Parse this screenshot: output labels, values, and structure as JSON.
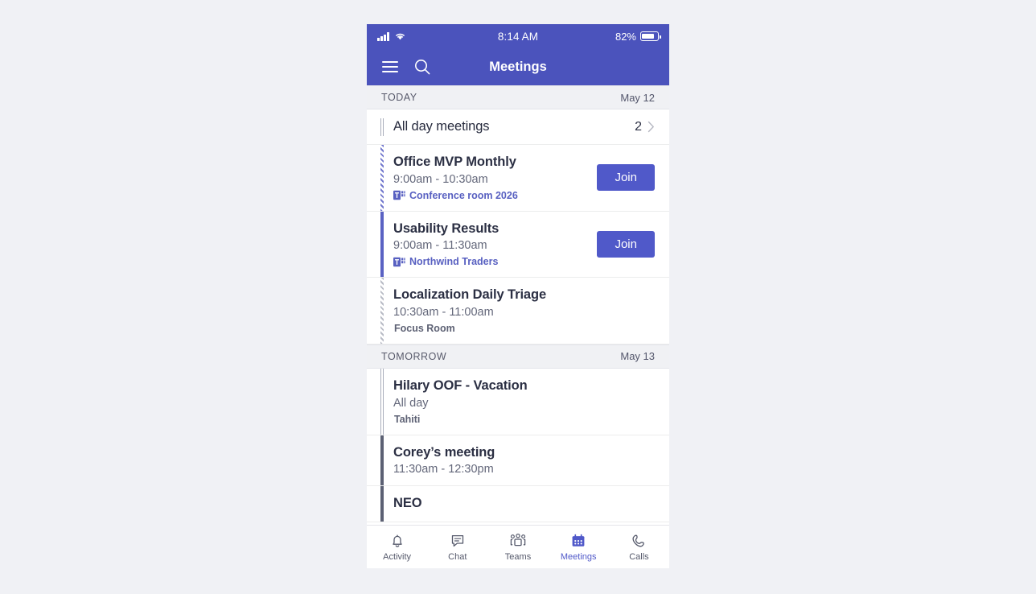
{
  "status_bar": {
    "time": "8:14 AM",
    "battery_percent": "82%",
    "battery_level": 82,
    "signal_icon": "cellular-signal-icon",
    "wifi_icon": "wifi-icon",
    "battery_icon": "battery-icon"
  },
  "app_bar": {
    "title": "Meetings",
    "menu_icon": "hamburger-menu-icon",
    "search_icon": "search-icon"
  },
  "colors": {
    "header_purple": "#4b53bc",
    "accent_purple": "#5059c9",
    "link_purple": "#5860c1",
    "section_bg": "#f0f1f4",
    "title_text": "#2b2f43",
    "secondary_text": "#63677a"
  },
  "sections": [
    {
      "label": "TODAY",
      "date": "May 12",
      "rows": [
        {
          "kind": "all-day-summary",
          "title": "All day meetings",
          "count": "2",
          "bar_style": "outline",
          "chevron_icon": "chevron-right-icon"
        },
        {
          "kind": "meeting",
          "title": "Office MVP Monthly",
          "time": "9:00am - 10:30am",
          "location": "Conference room 2026",
          "location_style": "teams",
          "location_icon": "teams-meeting-icon",
          "bar_style": "hatch-purple",
          "join_label": "Join",
          "has_join": true
        },
        {
          "kind": "meeting",
          "title": "Usability Results",
          "time": "9:00am - 11:30am",
          "location": "Northwind Traders",
          "location_style": "teams",
          "location_icon": "teams-meeting-icon",
          "bar_style": "solid-purple",
          "join_label": "Join",
          "has_join": true
        },
        {
          "kind": "meeting",
          "title": "Localization Daily Triage",
          "time": "10:30am - 11:00am",
          "location": "Focus Room",
          "location_style": "plain",
          "bar_style": "hatch-gray",
          "has_join": false
        }
      ]
    },
    {
      "label": "TOMORROW",
      "date": "May 13",
      "rows": [
        {
          "kind": "meeting",
          "title": "Hilary OOF - Vacation",
          "time": "All day",
          "location": "Tahiti",
          "location_style": "plain",
          "bar_style": "outline",
          "has_join": false
        },
        {
          "kind": "meeting",
          "title": "Corey’s meeting",
          "time": "11:30am - 12:30pm",
          "location": "",
          "location_style": "none",
          "bar_style": "solid-slate",
          "has_join": false
        },
        {
          "kind": "meeting-clipped",
          "title": "NEO",
          "time": "",
          "location": "",
          "location_style": "none",
          "bar_style": "solid-slate",
          "has_join": false
        }
      ]
    }
  ],
  "tab_bar": {
    "items": [
      {
        "label": "Activity",
        "icon": "bell-icon",
        "active": false
      },
      {
        "label": "Chat",
        "icon": "chat-bubble-icon",
        "active": false
      },
      {
        "label": "Teams",
        "icon": "people-teams-icon",
        "active": false
      },
      {
        "label": "Meetings",
        "icon": "calendar-icon",
        "active": true
      },
      {
        "label": "Calls",
        "icon": "phone-icon",
        "active": false
      }
    ]
  }
}
